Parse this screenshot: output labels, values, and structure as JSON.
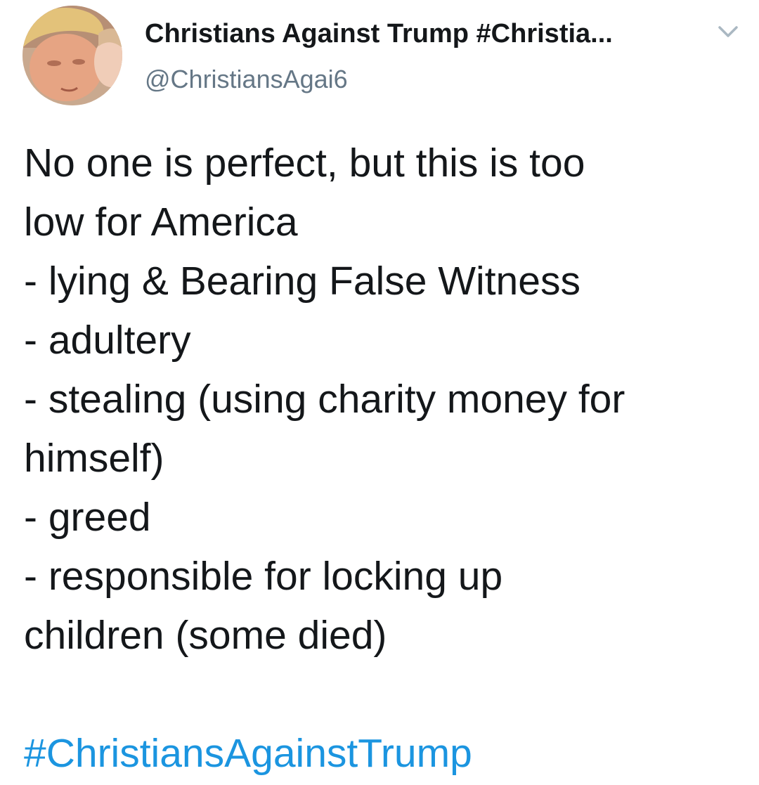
{
  "tweet": {
    "author": {
      "display_name": "Christians Against Trump #Christia...",
      "handle": "@ChristiansAgai6",
      "avatar_icon": "profile-photo"
    },
    "menu_icon": "chevron-down-icon",
    "body_lines": [
      "No one is perfect, but this is too",
      "low for America",
      "- lying & Bearing False Witness",
      "- adultery",
      "- stealing (using charity money for",
      "himself)",
      "- greed",
      "- responsible for locking up",
      "children (some died)"
    ],
    "hashtag": "#ChristiansAgainstTrump"
  },
  "colors": {
    "text": "#14171a",
    "secondary_text": "#657786",
    "link": "#1b95e0",
    "chevron": "#aab8c2",
    "background": "#ffffff"
  }
}
